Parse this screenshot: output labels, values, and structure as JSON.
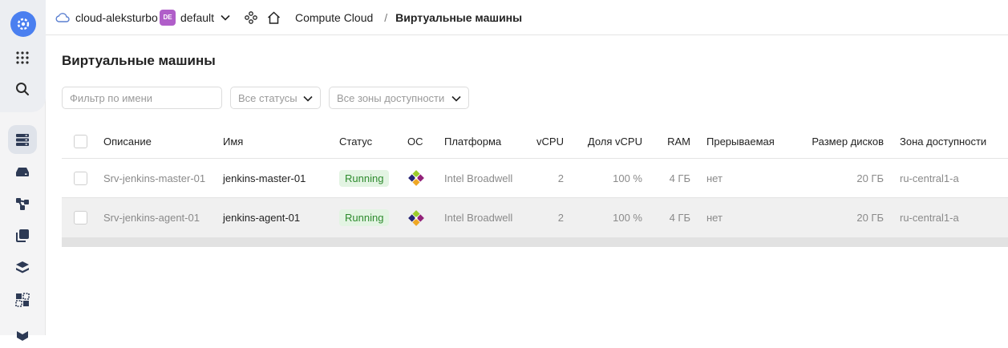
{
  "header": {
    "cloud_name": "cloud-aleksturbo",
    "folder_badge": "DE",
    "folder_name": "default",
    "service": "Compute Cloud",
    "separator": "/",
    "current_page": "Виртуальные машины"
  },
  "page": {
    "title": "Виртуальные машины"
  },
  "filters": {
    "name_placeholder": "Фильтр по имени",
    "status_select": "Все статусы",
    "zone_select": "Все зоны доступности"
  },
  "table": {
    "columns": {
      "description": "Описание",
      "name": "Имя",
      "status": "Статус",
      "os": "ОС",
      "platform": "Платформа",
      "vcpu": "vCPU",
      "vcpu_share": "Доля vCPU",
      "ram": "RAM",
      "preemptible": "Прерываемая",
      "disk_size": "Размер дисков",
      "zone": "Зона доступности"
    },
    "rows": [
      {
        "description": "Srv-jenkins-master-01",
        "name": "jenkins-master-01",
        "status": "Running",
        "os_icon": "centos-icon",
        "platform": "Intel Broadwell",
        "vcpu": "2",
        "vcpu_share": "100 %",
        "ram": "4 ГБ",
        "preemptible": "нет",
        "disk_size": "20 ГБ",
        "zone": "ru-central1-a"
      },
      {
        "description": "Srv-jenkins-agent-01",
        "name": "jenkins-agent-01",
        "status": "Running",
        "os_icon": "centos-icon",
        "platform": "Intel Broadwell",
        "vcpu": "2",
        "vcpu_share": "100 %",
        "ram": "4 ГБ",
        "preemptible": "нет",
        "disk_size": "20 ГБ",
        "zone": "ru-central1-a"
      }
    ]
  },
  "colors": {
    "accent": "#4a7ff0",
    "folder_badge": "#b05ec9",
    "status_running_bg": "#e3f4e3",
    "status_running_text": "#2e8b2e"
  }
}
